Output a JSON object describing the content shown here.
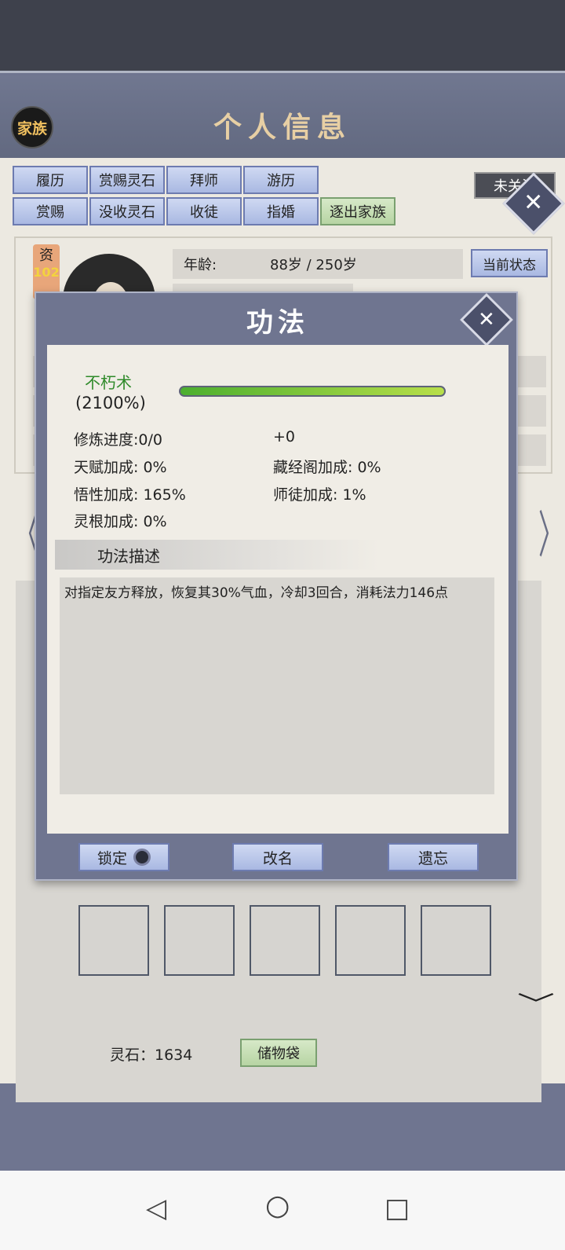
{
  "window": {
    "title": "个人信息",
    "family_badge": "家族",
    "close_icon": "close-icon"
  },
  "tabs_row1": [
    "履历",
    "赏赐灵石",
    "拜师",
    "游历"
  ],
  "tabs_row2": [
    "赏赐",
    "没收灵石",
    "收徒",
    "指婚",
    "逐出家族"
  ],
  "follow_label": "未关注",
  "profile": {
    "aptitude_label": "资",
    "aptitude_value": "102",
    "age_key": "年龄:",
    "age_value": "88岁 / 250岁",
    "state_button": "当前状态"
  },
  "dialog": {
    "title": "功法",
    "skill_name": "不朽术",
    "skill_percent": "(2100%)",
    "progress_fraction": 1.0,
    "stats": {
      "cultivation": "修炼进度:0/0",
      "bonus": "+0",
      "talent": "天赋加成:  0%",
      "library": "藏经阁加成:  0%",
      "comprehension": "悟性加成:  165%",
      "mentor": "师徒加成:    1%",
      "root": "灵根加成:  0%"
    },
    "desc_header": "功法描述",
    "description": "对指定友方释放，恢复其30%气血，冷却3回合，消耗法力146点",
    "buttons": {
      "lock": "锁定",
      "rename": "改名",
      "forget": "遗忘"
    }
  },
  "footer": {
    "spirit_stones": "灵石：1634",
    "bag_button": "储物袋"
  },
  "nav": {
    "back": "◁",
    "home": "○",
    "recent": "□"
  },
  "colors": {
    "frame": "#6f7590",
    "panel": "#ece9e1",
    "skill_name": "#2f8a2a",
    "tab_blue": "#a9b8e2",
    "tab_green": "#b7d4a3"
  }
}
